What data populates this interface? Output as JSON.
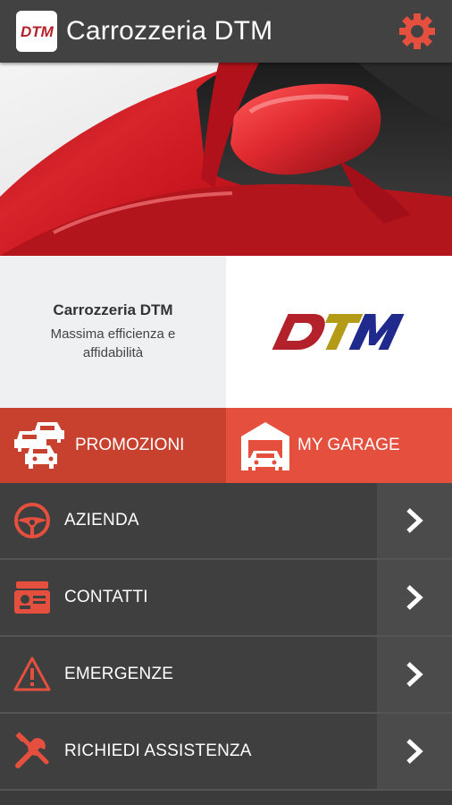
{
  "header": {
    "title": "Carrozzeria DTM",
    "logo_text": "DTM",
    "settings_icon": "gear-icon",
    "accent": "#e4503d"
  },
  "info": {
    "title": "Carrozzeria DTM",
    "subtitle": "Massima efficienza e affidabilità",
    "logo_text": "DTM"
  },
  "actions": {
    "promo_label": "PROMOZIONI",
    "garage_label": "MY GARAGE"
  },
  "menu": {
    "items": [
      {
        "label": "AZIENDA",
        "icon": "steering-wheel-icon"
      },
      {
        "label": "CONTATTI",
        "icon": "contact-card-icon"
      },
      {
        "label": "EMERGENZE",
        "icon": "warning-icon"
      },
      {
        "label": "RICHIEDI ASSISTENZA",
        "icon": "tools-icon"
      }
    ]
  },
  "colors": {
    "appbar": "#424242",
    "menu_bg": "#3f3f3f",
    "red_dark": "#c8412e",
    "red_light": "#e4503d",
    "dtm_red": "#b3212a",
    "dtm_gold": "#b39b18",
    "dtm_blue": "#1f2a8c"
  }
}
